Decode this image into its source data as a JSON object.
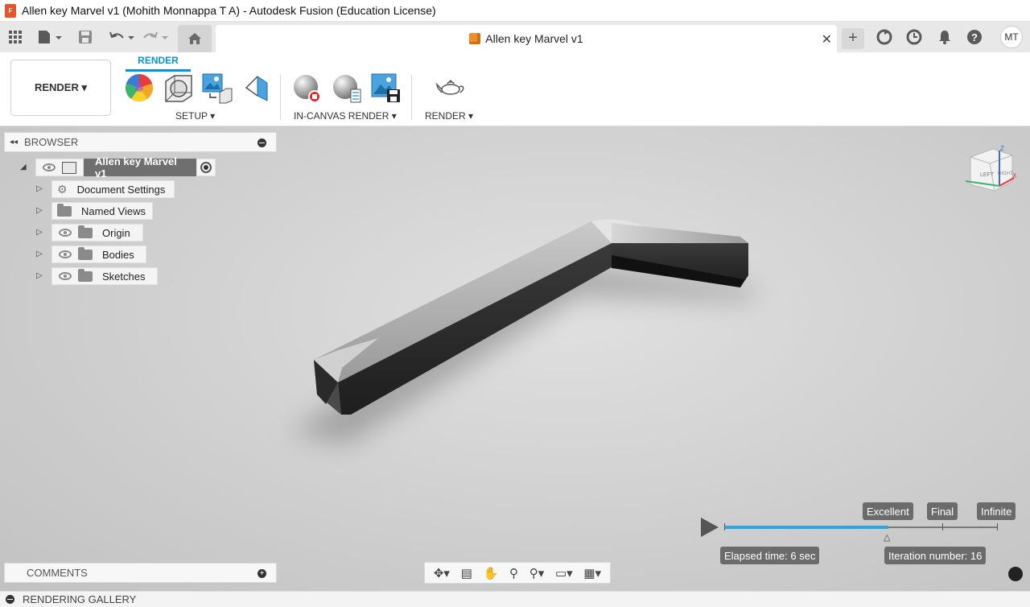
{
  "window": {
    "title": "Allen key Marvel v1 (Mohith Monnappa T A) - Autodesk Fusion (Education License)",
    "app_icon_text": "F"
  },
  "tabbar": {
    "doc_tab_label": "Allen key Marvel v1",
    "close_glyph": "✕",
    "new_tab_glyph": "+",
    "avatar_initials": "MT"
  },
  "toolbar": {
    "workspace_button": "RENDER ▾",
    "workspace_tab": "RENDER",
    "groups": {
      "setup": "SETUP ▾",
      "in_canvas_render": "IN-CANVAS RENDER ▾",
      "render": "RENDER ▾"
    }
  },
  "browser": {
    "header": "BROWSER",
    "collapse_glyph": "◂◂",
    "root": {
      "label": "Allen key Marvel v1",
      "expander": "◢"
    },
    "nodes": [
      {
        "label": "Document Settings",
        "expander": "▷"
      },
      {
        "label": "Named Views",
        "expander": "▷"
      },
      {
        "label": "Origin",
        "expander": "▷"
      },
      {
        "label": "Bodies",
        "expander": "▷"
      },
      {
        "label": "Sketches",
        "expander": "▷"
      }
    ]
  },
  "viewcube": {
    "left": "LEFT",
    "right": "RIGHT",
    "axis_z": "Z",
    "axis_x": "X"
  },
  "comments": {
    "label": "COMMENTS",
    "add_glyph": "+"
  },
  "render_progress": {
    "quality_levels": [
      "Excellent",
      "Final",
      "Infinite"
    ],
    "elapsed": "Elapsed time: 6 sec",
    "iteration": "Iteration number: 16",
    "progress_fraction": 0.6
  },
  "gallery": {
    "label": "RENDERING GALLERY"
  },
  "colors": {
    "accent": "#0696d7",
    "progress": "#2aa6e3"
  }
}
